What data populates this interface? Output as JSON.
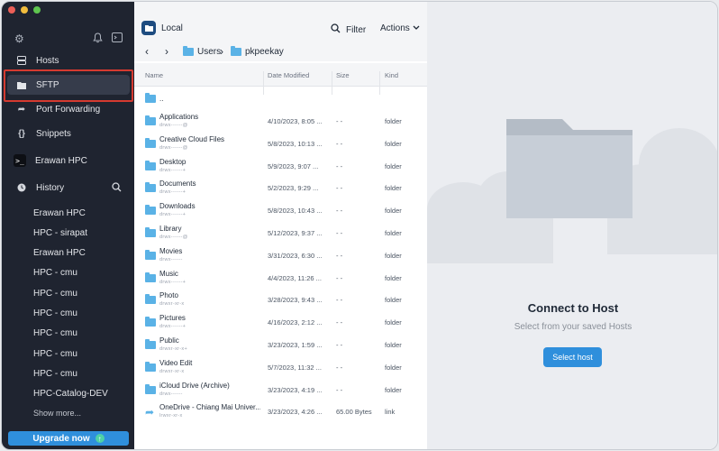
{
  "sidebar": {
    "nav": [
      {
        "label": "Hosts",
        "icon": "hosts-icon"
      },
      {
        "label": "SFTP",
        "icon": "folder-icon",
        "active": true
      },
      {
        "label": "Port Forwarding",
        "icon": "port-forwarding-icon"
      },
      {
        "label": "Snippets",
        "icon": "snippets-icon"
      },
      {
        "label": "Erawan HPC",
        "icon": "terminal-icon"
      }
    ],
    "history_label": "History",
    "history": [
      "Erawan HPC",
      "HPC - sirapat",
      "Erawan HPC",
      "HPC - cmu",
      "HPC - cmu",
      "HPC - cmu",
      "HPC - cmu",
      "HPC - cmu",
      "HPC - cmu",
      "HPC-Catalog-DEV"
    ],
    "show_more": "Show more...",
    "upgrade": "Upgrade now"
  },
  "pane": {
    "title": "Local",
    "filter": "Filter",
    "actions": "Actions",
    "path": [
      "Users",
      "pkpeekay"
    ],
    "columns": {
      "name": "Name",
      "date": "Date Modified",
      "size": "Size",
      "kind": "Kind"
    },
    "parent": "..",
    "rows": [
      {
        "name": "Applications",
        "perm": "drwx------@",
        "date": "4/10/2023, 8:05 ...",
        "size": "- -",
        "kind": "folder"
      },
      {
        "name": "Creative Cloud Files",
        "perm": "drwx------@",
        "date": "5/8/2023, 10:13 ...",
        "size": "- -",
        "kind": "folder"
      },
      {
        "name": "Desktop",
        "perm": "drwx------+",
        "date": "5/9/2023, 9:07 ...",
        "size": "- -",
        "kind": "folder"
      },
      {
        "name": "Documents",
        "perm": "drwx------+",
        "date": "5/2/2023, 9:29 ...",
        "size": "- -",
        "kind": "folder"
      },
      {
        "name": "Downloads",
        "perm": "drwx------+",
        "date": "5/8/2023, 10:43 ...",
        "size": "- -",
        "kind": "folder"
      },
      {
        "name": "Library",
        "perm": "drwx------@",
        "date": "5/12/2023, 9:37 ...",
        "size": "- -",
        "kind": "folder"
      },
      {
        "name": "Movies",
        "perm": "drwx------",
        "date": "3/31/2023, 6:30 ...",
        "size": "- -",
        "kind": "folder"
      },
      {
        "name": "Music",
        "perm": "drwx------+",
        "date": "4/4/2023, 11:26 ...",
        "size": "- -",
        "kind": "folder"
      },
      {
        "name": "Photo",
        "perm": "drwxr-xr-x",
        "date": "3/28/2023, 9:43 ...",
        "size": "- -",
        "kind": "folder"
      },
      {
        "name": "Pictures",
        "perm": "drwx------+",
        "date": "4/16/2023, 2:12 ...",
        "size": "- -",
        "kind": "folder"
      },
      {
        "name": "Public",
        "perm": "drwxr-xr-x+",
        "date": "3/23/2023, 1:59 ...",
        "size": "- -",
        "kind": "folder"
      },
      {
        "name": "Video Edit",
        "perm": "drwxr-xr-x",
        "date": "5/7/2023, 11:32 ...",
        "size": "- -",
        "kind": "folder"
      },
      {
        "name": "iCloud Drive (Archive)",
        "perm": "drwx------",
        "date": "3/23/2023, 4:19 ...",
        "size": "- -",
        "kind": "folder"
      },
      {
        "name": "OneDrive - Chiang Mai Univer...",
        "perm": "lrwxr-xr-x",
        "date": "3/23/2023, 4:26 ...",
        "size": "65.00 Bytes",
        "kind": "link"
      }
    ]
  },
  "host": {
    "title": "Connect to Host",
    "subtitle": "Select from your saved Hosts",
    "button": "Select host"
  },
  "colors": {
    "sidebar_bg": "#1f2430",
    "accent": "#2f8fdc",
    "folder": "#5ab2e6",
    "highlight": "#d53a30"
  }
}
